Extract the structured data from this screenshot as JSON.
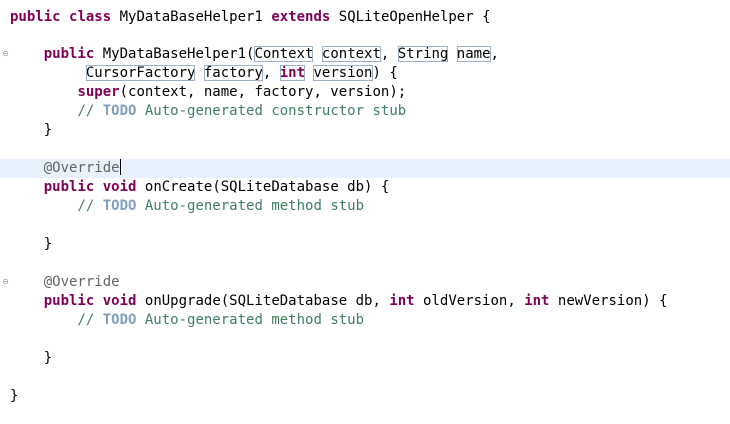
{
  "lines": [
    {
      "keyword1": "public",
      "keyword2": "class",
      "class_name": "MyDataBaseHelper1",
      "keyword3": "extends",
      "parent": "SQLiteOpenHelper {"
    },
    {},
    {
      "indent": "    ",
      "keyword": "public",
      "ctor": "MyDataBaseHelper1(",
      "type1": "Context",
      "param1": "context",
      "sep1": ", ",
      "type2": "String",
      "param2": "name",
      "tail": ","
    },
    {
      "indent": "         ",
      "type3": "CursorFactory",
      "param3": "factory",
      "sep": ", ",
      "keyword": "int",
      "param4": "version",
      "tail": ") {"
    },
    {
      "indent": "        ",
      "keyword": "super",
      "rest": "(context, name, factory, version);"
    },
    {
      "indent": "        ",
      "comment_start": "// ",
      "todo": "TODO",
      "comment_rest": " Auto-generated constructor stub"
    },
    {
      "text": "    }"
    },
    {},
    {
      "indent": "    ",
      "annotation": "@Override"
    },
    {
      "indent": "    ",
      "keyword1": "public",
      "keyword2": "void",
      "rest": "onCreate(SQLiteDatabase db) {"
    },
    {
      "indent": "        ",
      "comment_start": "// ",
      "todo": "TODO",
      "comment_rest": " Auto-generated method stub"
    },
    {},
    {
      "text": "    }"
    },
    {},
    {
      "indent": "    ",
      "annotation": "@Override"
    },
    {
      "indent": "    ",
      "keyword1": "public",
      "keyword2": "void",
      "method": "onUpgrade(SQLiteDatabase db, ",
      "keyword3": "int",
      "param1": " oldVersion, ",
      "keyword4": "int",
      "param2": " newVersion) {"
    },
    {
      "indent": "        ",
      "comment_start": "// ",
      "todo": "TODO",
      "comment_rest": " Auto-generated method stub"
    },
    {},
    {
      "text": "    }"
    },
    {},
    {
      "text": "}"
    }
  ],
  "icons": {
    "fold_marker": "collapse-icon",
    "fold_glyph": "⊖"
  },
  "colors": {
    "keyword": "#7f0055",
    "comment": "#3f7f5f",
    "todo": "#7f9fbf",
    "annotation": "#646464",
    "current_line": "#e8f2fe"
  }
}
